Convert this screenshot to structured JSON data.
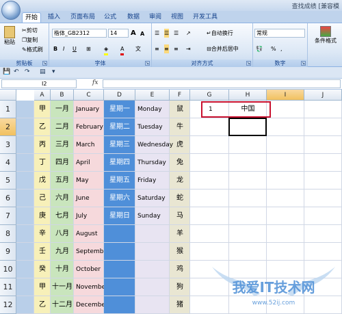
{
  "title": "查找成绩 [兼容模",
  "tabs": [
    "开始",
    "插入",
    "页面布局",
    "公式",
    "数据",
    "审阅",
    "视图",
    "开发工具"
  ],
  "ribbon": {
    "clipboard": {
      "label": "剪贴板",
      "paste": "粘贴",
      "cut": "剪切",
      "copy": "复制",
      "format_painter": "格式刷"
    },
    "font": {
      "label": "字体",
      "font_name": "楷体_GB2312",
      "font_size": "14",
      "bold": "B",
      "italic": "I",
      "underline": "U",
      "grow": "A",
      "shrink": "A"
    },
    "alignment": {
      "label": "对齐方式",
      "wrap": "自动换行",
      "merge": "合并后居中"
    },
    "number": {
      "label": "数字",
      "format": "常规",
      "percent": "%",
      "comma": ","
    },
    "styles": {
      "label": "条件格式"
    }
  },
  "formula_bar": {
    "name_box": "I2",
    "fx": "fx",
    "content": ""
  },
  "columns": [
    "A",
    "B",
    "C",
    "D",
    "E",
    "F",
    "G",
    "H",
    "I",
    "J"
  ],
  "selected_column": "I",
  "selected_row": "2",
  "rows": [
    {
      "n": "1",
      "B": "甲",
      "C": "一月",
      "D": "January",
      "E": "星期一",
      "F": "Monday",
      "G": "鼠",
      "H": "1",
      "I": "中国"
    },
    {
      "n": "2",
      "B": "乙",
      "C": "二月",
      "D": "February",
      "E": "星期二",
      "F": "Tuesday",
      "G": "牛",
      "H": "",
      "I": ""
    },
    {
      "n": "3",
      "B": "丙",
      "C": "三月",
      "D": "March",
      "E": "星期三",
      "F": "Wednesday",
      "G": "虎",
      "H": "",
      "I": ""
    },
    {
      "n": "4",
      "B": "丁",
      "C": "四月",
      "D": "April",
      "E": "星期四",
      "F": "Thursday",
      "G": "兔",
      "H": "",
      "I": ""
    },
    {
      "n": "5",
      "B": "戊",
      "C": "五月",
      "D": "May",
      "E": "星期五",
      "F": "Friday",
      "G": "龙",
      "H": "",
      "I": ""
    },
    {
      "n": "6",
      "B": "己",
      "C": "六月",
      "D": "June",
      "E": "星期六",
      "F": "Saturday",
      "G": "蛇",
      "H": "",
      "I": ""
    },
    {
      "n": "7",
      "B": "庚",
      "C": "七月",
      "D": "July",
      "E": "星期日",
      "F": "Sunday",
      "G": "马",
      "H": "",
      "I": ""
    },
    {
      "n": "8",
      "B": "辛",
      "C": "八月",
      "D": "August",
      "E": "",
      "F": "",
      "G": "羊",
      "H": "",
      "I": ""
    },
    {
      "n": "9",
      "B": "壬",
      "C": "九月",
      "D": "September",
      "E": "",
      "F": "",
      "G": "猴",
      "H": "",
      "I": ""
    },
    {
      "n": "10",
      "B": "癸",
      "C": "十月",
      "D": "October",
      "E": "",
      "F": "",
      "G": "鸡",
      "H": "",
      "I": ""
    },
    {
      "n": "11",
      "B": "甲",
      "C": "十一月",
      "D": "November",
      "E": "",
      "F": "",
      "G": "狗",
      "H": "",
      "I": ""
    },
    {
      "n": "12",
      "B": "乙",
      "C": "十二月",
      "D": "December",
      "E": "",
      "F": "",
      "G": "猪",
      "H": "",
      "I": ""
    }
  ],
  "watermark": {
    "text": "我爱IT技术网",
    "url": "www.52ij.com"
  },
  "colors": {
    "colA": "#b9cfe9",
    "colB": "#f7f0b9",
    "colC": "#c9e5bd",
    "colD": "#f6d9dc",
    "colE": "#4f8fd9",
    "colF": "#e8e4f2",
    "colG": "#e9e6d2",
    "highlight": "#c8102e"
  }
}
